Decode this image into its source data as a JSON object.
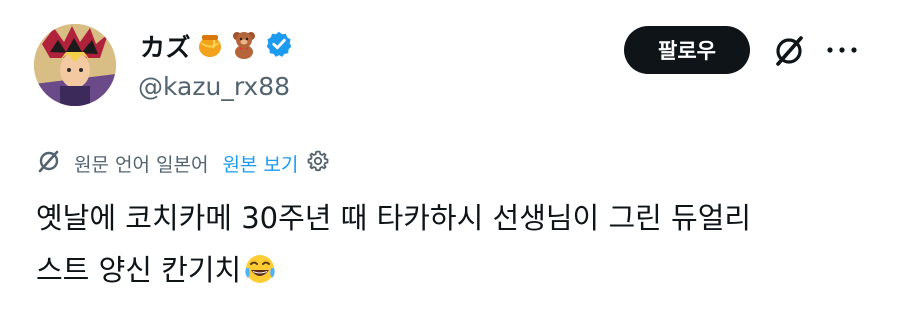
{
  "user": {
    "display_name": "カズ",
    "name_emojis": [
      "honey-pot",
      "teddy-bear"
    ],
    "handle": "@kazu_rx88",
    "verified": true
  },
  "actions": {
    "follow_label": "팔로우"
  },
  "translation": {
    "source_label": "원문 언어 일본어",
    "show_original_label": "원본 보기"
  },
  "tweet": {
    "lines": [
      "옛날에 코치카메 30주년 때 타카하시 선생님이 그린 듀얼리",
      "스트 양신 칸기치"
    ],
    "trailing_emoji": "face-with-tears-of-joy"
  },
  "colors": {
    "accent": "#1d9bf0",
    "text": "#0f1419",
    "muted": "#536471",
    "button_bg": "#0f1419"
  }
}
